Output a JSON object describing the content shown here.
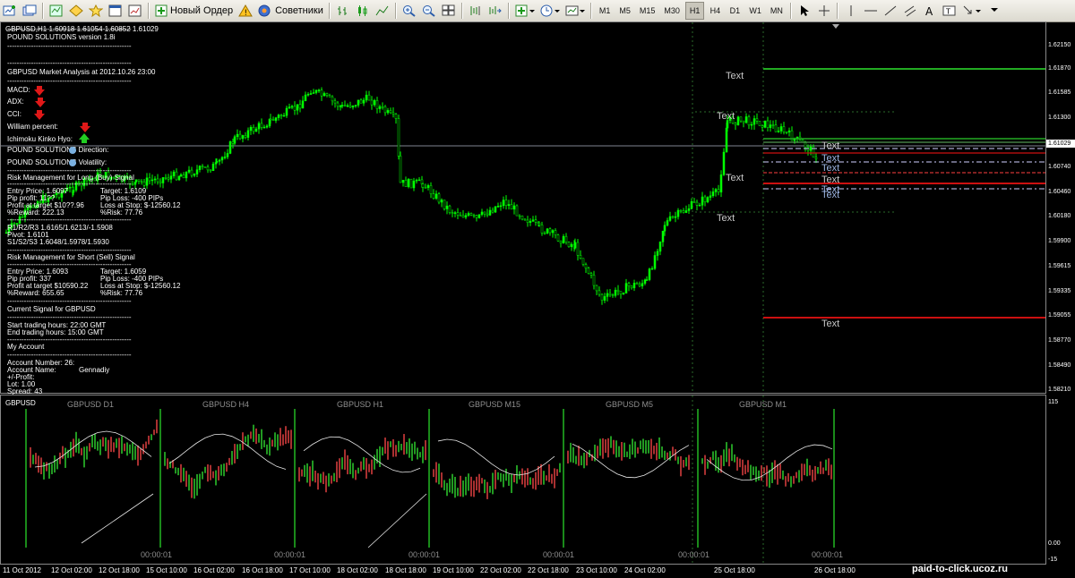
{
  "toolbar": {
    "new_order": "Новый Ордер",
    "advisors": "Советники",
    "timeframes": [
      "M1",
      "M5",
      "M15",
      "M30",
      "H1",
      "H4",
      "D1",
      "W1",
      "MN"
    ],
    "active_timeframe": "H1",
    "icons": [
      "new-chart-icon",
      "profiles-icon",
      "market-watch-icon",
      "navigator-icon",
      "favorites-icon",
      "terminal-icon",
      "strategy-tester-icon",
      "new-order-icon",
      "metaeditor-icon",
      "expert-advisors-icon",
      "bar-chart-icon",
      "candlestick-icon",
      "line-chart-icon",
      "zoom-in-icon",
      "zoom-out-icon",
      "tile-windows-icon",
      "chart-shift-icon",
      "autoscroll-icon",
      "indicators-icon",
      "periods-icon",
      "templates-icon",
      "cursor-icon",
      "crosshair-icon",
      "vertical-line-icon",
      "horizontal-line-icon",
      "trendline-icon",
      "channel-icon",
      "text-icon",
      "text-label-icon",
      "arrows-icon"
    ]
  },
  "chart": {
    "header": "GBPUSD,H1  1.60918 1.61054 1.60852 1.61029",
    "current_price": "1.61029",
    "prices": [
      "1.62150",
      "1.61870",
      "1.61585",
      "1.61300",
      "1.61029",
      "1.60740",
      "1.60460",
      "1.60180",
      "1.59900",
      "1.59615",
      "1.59335",
      "1.59055",
      "1.58770",
      "1.58490",
      "1.58210"
    ],
    "colors": {
      "bull": "#00ff00",
      "bear": "#ff3030",
      "line": "#ffffff",
      "support": "#cc1010",
      "resistance": "#22aa22"
    }
  },
  "panel": {
    "title": "POUND SOLUTIONS version 1.8i",
    "sep": "----------------------------------------------------",
    "analysis": "GBPUSD Market Analysis at 2012.10.26 23:00",
    "macd": "MACD:",
    "adx": "ADX:",
    "cci": "CCI:",
    "william": "William percent:",
    "ichimoku": "Ichimoku Kinko Hyo:",
    "direction": "POUND SOLUTIONS Direction:",
    "volatility": "POUND SOLUTIONS Volatility:",
    "rm_long": "Risk Management for Long (Buy) Signal",
    "long_lines": [
      "Entry Price: 1.6097",
      "Pip profit: 11??",
      "Profit at target $10??.96",
      "%Reward: 222.13"
    ],
    "long_lines_r": [
      "Target: 1.6109",
      "Pip Loss: -400 PIPs",
      "Loss at Stop: $-12560.12",
      "%Risk: 77.76"
    ],
    "pivots": [
      "R1/R2/R3 1.6165/1.6213/-1.5908",
      "Pivot: 1.6101",
      "S1/S2/S3 1.6048/1.5978/1.5930"
    ],
    "rm_short": "Risk Management for Short (Sell) Signal",
    "short_lines": [
      "Entry Price: 1.6093",
      "Pip profit: 337",
      "Profit at target $10590.22",
      "%Reward: 655.65"
    ],
    "short_lines_r": [
      "Target: 1.6059",
      "Pip Loss: -400 PIPs",
      "Loss at Stop: $-12560.12",
      "%Risk: 77.76"
    ],
    "signal": "Current Signal for GBPUSD",
    "hours": [
      "Start trading hours: 22:00 GMT",
      "End trading hours:  15:00 GMT"
    ],
    "account": "My Account",
    "acc_lines": [
      "Account Number: 26:",
      "Account Name:",
      "+/-Profit:",
      "Lot: 1.00",
      "Spread: 43"
    ],
    "acc_name": "Gennadiy"
  },
  "objects": {
    "text": "Text"
  },
  "subwindow": {
    "name": "GBPUSD",
    "labels": [
      "GBPUSD D1",
      "GBPUSD H4",
      "GBPUSD H1",
      "GBPUSD M15",
      "GBPUSD M5",
      "GBPUSD M1"
    ],
    "clock": "00:00:01",
    "scale_top": "115",
    "scale_bottom": "0.00",
    "scale_bottom2": "-15"
  },
  "xaxis": [
    "11 Oct 2012",
    "12 Oct 02:00",
    "12 Oct 18:00",
    "15 Oct 10:00",
    "16 Oct 02:00",
    "16 Oct 18:00",
    "17 Oct 10:00",
    "18 Oct 02:00",
    "18 Oct 18:00",
    "19 Oct 10:00",
    "22 Oct 02:00",
    "22 Oct 18:00",
    "23 Oct 10:00",
    "24 Oct 02:00",
    "25 Oct 18:00",
    "26 Oct 18:00"
  ],
  "watermark": "paid-to-click.ucoz.ru"
}
